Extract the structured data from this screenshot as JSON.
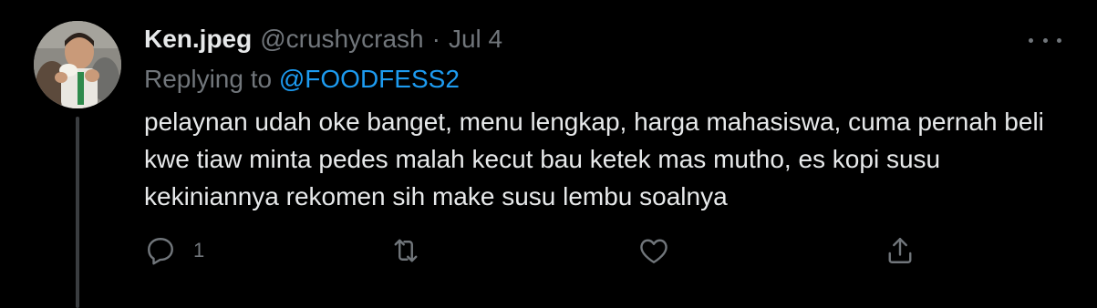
{
  "tweet": {
    "display_name": "Ken.jpeg",
    "handle": "@crushycrash",
    "separator": "·",
    "date": "Jul 4",
    "replying_prefix": "Replying to",
    "replying_to": "@FOODFESS2",
    "text": "pelaynan udah oke banget, menu lengkap, harga mahasiswa, cuma pernah beli kwe tiaw minta pedes malah kecut bau ketek mas mutho, es kopi susu kekiniannya rekomen sih make susu lembu soalnya",
    "reply_count": "1"
  },
  "icons": {
    "more": "more-horizontal-icon",
    "reply": "reply-bubble-icon",
    "retweet": "retweet-icon",
    "like": "heart-icon",
    "share": "share-icon"
  },
  "colors": {
    "background": "#000000",
    "primary_text": "#e7e9ea",
    "secondary_text": "#71767b",
    "accent": "#1d9bf0",
    "thread_line": "#3a3d40"
  }
}
